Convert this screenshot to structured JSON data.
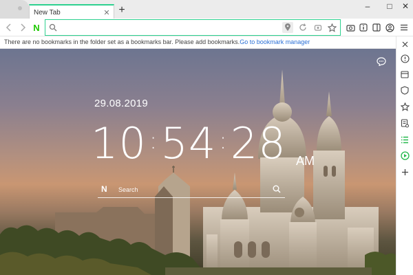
{
  "tab": {
    "title": "New Tab",
    "close_label": "✕"
  },
  "tabstrip": {
    "new_tab_label": "+"
  },
  "window": {
    "minimize": "–",
    "maximize": "□",
    "close": "✕"
  },
  "omnibox": {
    "value": "",
    "placeholder": ""
  },
  "bookmarkbar": {
    "message": "There are no bookmarks in the folder set as a bookmarks bar. Please add bookmarks.",
    "link": "Go to bookmark manager"
  },
  "newtab": {
    "date": "29.08.2019",
    "hour": "10",
    "minute": "54",
    "second": "28",
    "ampm": "AM",
    "search_placeholder": "Search",
    "search_brand": "N"
  },
  "colors": {
    "accent": "#2dd18f",
    "naver_green": "#1ec800",
    "link": "#2a6fd6"
  }
}
